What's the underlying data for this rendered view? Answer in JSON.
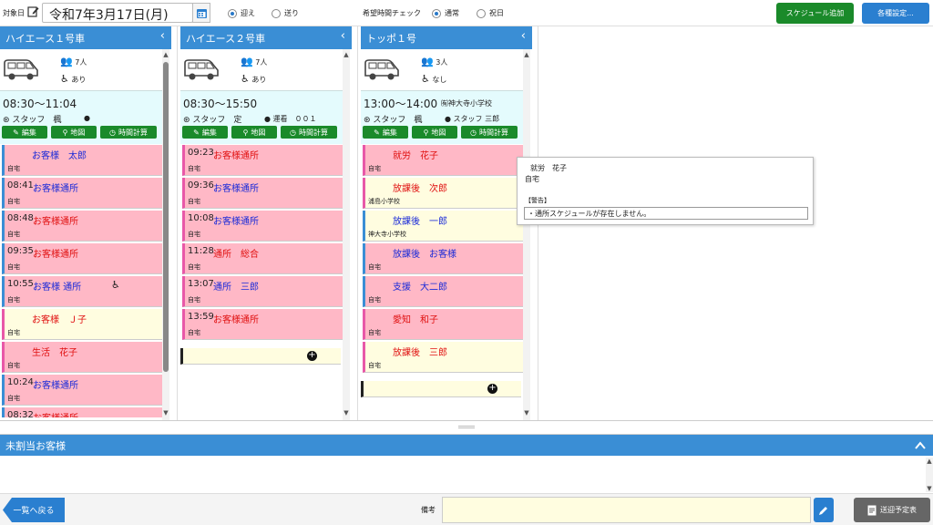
{
  "topbar": {
    "date_label": "対象日",
    "date_value": "令和7年3月17日(月)",
    "direction": {
      "pickup": "迎え",
      "dropoff": "送り",
      "selected": "pickup"
    },
    "hope_time_label": "希望時間チェック",
    "day_type": {
      "normal": "通常",
      "holiday": "祝日",
      "selected": "normal"
    },
    "add_schedule": "スケジュール追加",
    "settings": "各種設定..."
  },
  "vehicles": [
    {
      "name": "ハイエース１号車",
      "count": "7人",
      "wheelchair": "あり",
      "time": "08:30〜11:04",
      "sub": "",
      "staff": "スタッフ　楓",
      "driver": "",
      "buttons": [
        "編集",
        "地図",
        "時間計算"
      ],
      "passengers": [
        {
          "time": "",
          "name": "お客様　太郎",
          "place": "自宅",
          "color": "blue",
          "bg": "pink",
          "border": "blue"
        },
        {
          "time": "08:41",
          "name": "お客様通所",
          "place": "自宅",
          "color": "blue",
          "bg": "pink",
          "border": "blue"
        },
        {
          "time": "08:48",
          "name": "お客様通所",
          "place": "自宅",
          "color": "red",
          "bg": "pink",
          "border": "blue"
        },
        {
          "time": "09:35",
          "name": "お客様通所",
          "place": "自宅",
          "color": "red",
          "bg": "pink",
          "border": "blue"
        },
        {
          "time": "10:55",
          "name": "お客様 通所",
          "place": "自宅",
          "color": "blue",
          "bg": "pink",
          "border": "blue",
          "wheelchair": true
        },
        {
          "time": "",
          "name": "お客様　Ｊ子",
          "place": "自宅",
          "color": "red",
          "bg": "yel",
          "border": "pink"
        },
        {
          "time": "",
          "name": "生活　花子",
          "place": "自宅",
          "color": "red",
          "bg": "pink",
          "border": "pink"
        },
        {
          "time": "10:24",
          "name": "お客様通所",
          "place": "自宅",
          "color": "blue",
          "bg": "pink",
          "border": "blue"
        },
        {
          "time": "08:32",
          "name": "お客様通所",
          "place": "",
          "color": "red",
          "bg": "pink",
          "border": "blue"
        }
      ]
    },
    {
      "name": "ハイエース２号車",
      "count": "7人",
      "wheelchair": "あり",
      "time": "08:30〜15:50",
      "sub": "",
      "staff": "スタッフ　定",
      "driver": "運看　００１",
      "buttons": [
        "編集",
        "地図",
        "時間計算"
      ],
      "passengers": [
        {
          "time": "09:23",
          "name": "お客様通所",
          "place": "自宅",
          "color": "red",
          "bg": "pink",
          "border": "pink"
        },
        {
          "time": "09:36",
          "name": "お客様通所",
          "place": "自宅",
          "color": "blue",
          "bg": "pink",
          "border": "pink"
        },
        {
          "time": "10:08",
          "name": "お客様通所",
          "place": "自宅",
          "color": "blue",
          "bg": "pink",
          "border": "pink"
        },
        {
          "time": "11:28",
          "name": "通所　総合",
          "place": "自宅",
          "color": "red",
          "bg": "pink",
          "border": "pink"
        },
        {
          "time": "13:07",
          "name": "通所　三郎",
          "place": "自宅",
          "color": "blue",
          "bg": "pink",
          "border": "pink"
        },
        {
          "time": "13:59",
          "name": "お客様通所",
          "place": "自宅",
          "color": "red",
          "bg": "pink",
          "border": "pink"
        }
      ]
    },
    {
      "name": "トッポ１号",
      "count": "3人",
      "wheelchair": "なし",
      "time": "13:00〜14:00",
      "sub": "㈲神大寺小学校",
      "staff": "スタッフ　楓",
      "driver": "スタッフ 三郎",
      "buttons": [
        "編集",
        "地図",
        "時間計算"
      ],
      "passengers": [
        {
          "time": "",
          "name": "就労　花子",
          "place": "自宅",
          "color": "red",
          "bg": "pink",
          "border": "pink"
        },
        {
          "time": "",
          "name": "放課後　次郎",
          "place": "浦島小学校",
          "color": "red",
          "bg": "yel",
          "border": "pink"
        },
        {
          "time": "",
          "name": "放課後　一郎",
          "place": "神大寺小学校",
          "color": "blue",
          "bg": "yel",
          "border": "blue"
        },
        {
          "time": "",
          "name": "放課後　お客様",
          "place": "自宅",
          "color": "blue",
          "bg": "pink",
          "border": "blue"
        },
        {
          "time": "",
          "name": "支援　大二郎",
          "place": "自宅",
          "color": "blue",
          "bg": "pink",
          "border": "blue"
        },
        {
          "time": "",
          "name": "愛知　和子",
          "place": "自宅",
          "color": "red",
          "bg": "pink",
          "border": "pink"
        },
        {
          "time": "",
          "name": "放課後　三郎",
          "place": "自宅",
          "color": "red",
          "bg": "yel",
          "border": "pink"
        }
      ]
    }
  ],
  "popup": {
    "name": "就労　花子",
    "place": "自宅",
    "warning_title": "【警告】",
    "warning_text": "・通所スケジュールが存在しません。"
  },
  "unassigned_title": "未割当お客様",
  "bottom": {
    "back": "一覧へ戻る",
    "memo_label": "備考",
    "print": "送迎予定表"
  }
}
